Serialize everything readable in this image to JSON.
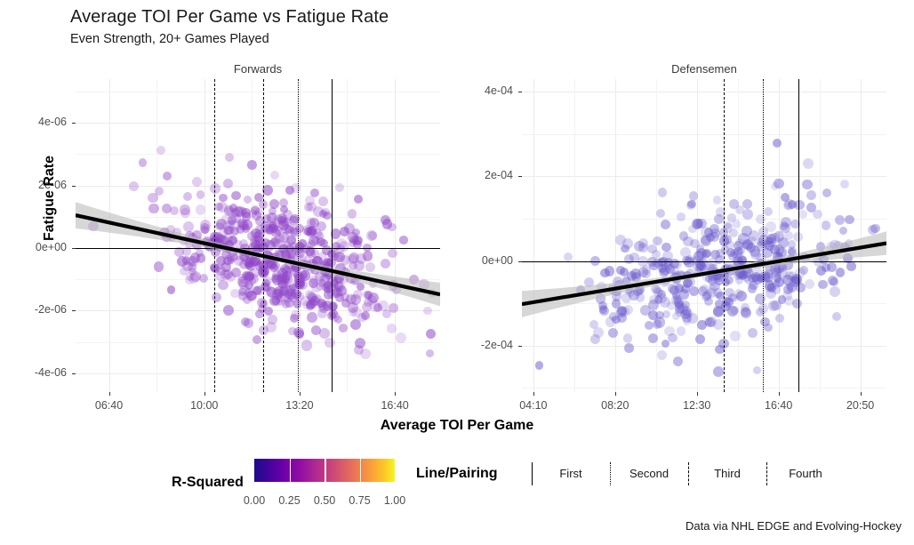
{
  "header": {
    "title": "Average TOI Per Game vs Fatigue Rate",
    "subtitle": "Even Strength, 20+ Games Played"
  },
  "caption": "Data via NHL EDGE and Evolving-Hockey",
  "axis": {
    "x_title": "Average TOI Per Game",
    "y_title": "Fatigue Rate"
  },
  "legends": {
    "rsquared": {
      "title": "R-Squared",
      "ticks": [
        "0.00",
        "0.25",
        "0.50",
        "0.75",
        "1.00"
      ],
      "colors": [
        "#1b0c8a",
        "#8f0da4",
        "#cc4778",
        "#f2844b",
        "#f0f921"
      ]
    },
    "line_pairing": {
      "title": "Line/Pairing",
      "items": [
        {
          "label": "First",
          "style": "solid"
        },
        {
          "label": "Second",
          "style": "dotted"
        },
        {
          "label": "Third",
          "style": "dash-dot"
        },
        {
          "label": "Fourth",
          "style": "dashed"
        }
      ]
    }
  },
  "chart_data": {
    "type": "scatter",
    "title": "Average TOI Per Game vs Fatigue Rate",
    "subtitle": "Even Strength, 20+ Games Played",
    "xlabel": "Average TOI Per Game",
    "ylabel": "Fatigue Rate",
    "grid": true,
    "legend_position": "bottom",
    "point_color_scale": "plasma",
    "facets": [
      {
        "name": "Forwards",
        "xticks": [
          "06:40",
          "10:00",
          "13:20",
          "16:40"
        ],
        "xtick_values": [
          400,
          600,
          800,
          1000
        ],
        "xlim": [
          330,
          1095
        ],
        "yticks": [
          "4e-06",
          "2e-06",
          "0e+00",
          "-2e-06",
          "-4e-06"
        ],
        "ytick_values": [
          4e-06,
          2e-06,
          0,
          -2e-06,
          -4e-06
        ],
        "ylim": [
          -4.6e-06,
          5.4e-06
        ],
        "n_points": 560,
        "point_color": "#8e44c8",
        "point_opacity": 0.42,
        "trend": {
          "slope_sign": "negative",
          "y_at_xmin": 1.05e-06,
          "y_at_xmax": -1.48e-06
        },
        "reference_lines": [
          {
            "label": "Fourth",
            "x_value": 621,
            "style": "dashed"
          },
          {
            "label": "Third",
            "x_value": 724,
            "style": "dashed"
          },
          {
            "label": "Second",
            "x_value": 796,
            "style": "dotted"
          },
          {
            "label": "First",
            "x_value": 868,
            "style": "solid"
          }
        ]
      },
      {
        "name": "Defensemen",
        "xticks": [
          "04:10",
          "08:20",
          "12:30",
          "16:40",
          "20:50"
        ],
        "xtick_values": [
          250,
          500,
          750,
          1000,
          1250
        ],
        "xlim": [
          215,
          1330
        ],
        "yticks": [
          "4e-04",
          "2e-04",
          "0e+00",
          "-2e-04"
        ],
        "ytick_values": [
          0.0004,
          0.0002,
          0,
          -0.0002
        ],
        "ylim": [
          -0.00031,
          0.00043
        ],
        "n_points": 430,
        "point_color": "#6a5acd",
        "point_opacity": 0.4,
        "trend": {
          "slope_sign": "positive",
          "y_at_xmin": -0.000102,
          "y_at_xmax": 4.2e-05
        },
        "reference_lines": [
          {
            "label": "Fourth",
            "x_value": 833,
            "style": "dashed"
          },
          {
            "label": "Third",
            "x_value": 952,
            "style": "dotted"
          },
          {
            "label": "First",
            "x_value": 1062,
            "style": "solid"
          }
        ]
      }
    ]
  }
}
